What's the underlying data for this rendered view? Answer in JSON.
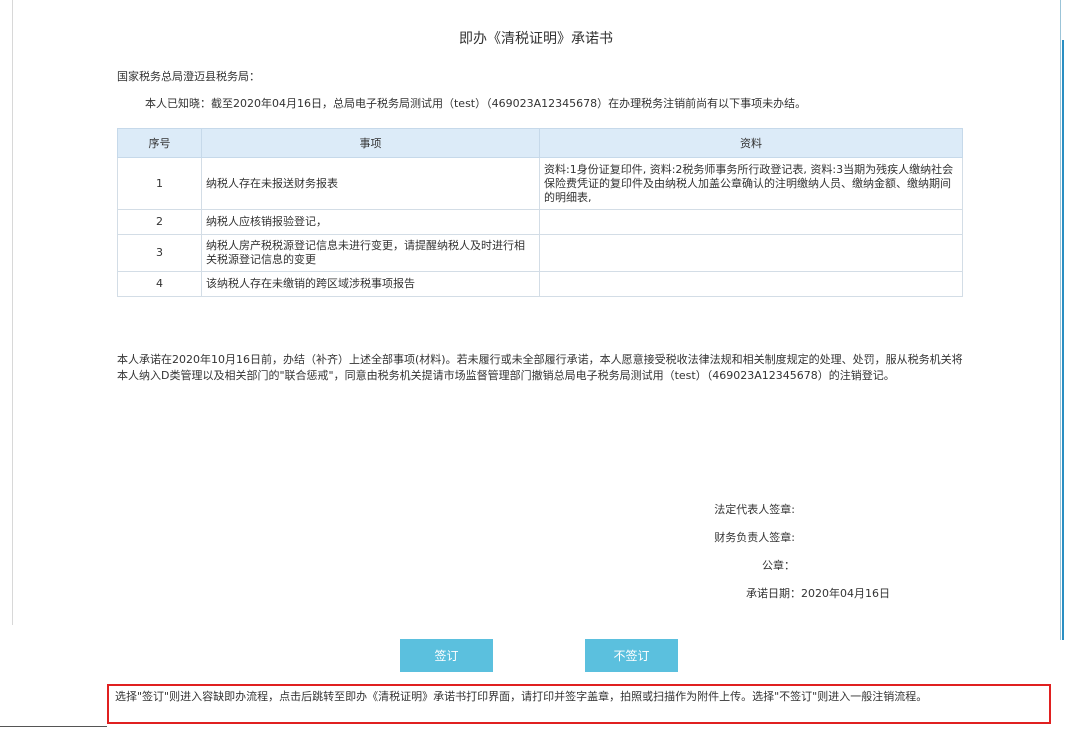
{
  "title": "即办《清税证明》承诺书",
  "addressee": "国家税务总局澄迈县税务局：",
  "intro": "本人已知晓：截至2020年04月16日，总局电子税务局测试用（test）（469023A12345678）在办理税务注销前尚有以下事项未办结。",
  "table": {
    "headers": [
      "序号",
      "事项",
      "资料"
    ],
    "rows": [
      {
        "num": "1",
        "item": "纳税人存在未报送财务报表",
        "material": "资料:1身份证复印件, 资料:2税务师事务所行政登记表, 资料:3当期为残疾人缴纳社会保险费凭证的复印件及由纳税人加盖公章确认的注明缴纳人员、缴纳金额、缴纳期间的明细表,"
      },
      {
        "num": "2",
        "item": "纳税人应核销报验登记，",
        "material": ""
      },
      {
        "num": "3",
        "item": "纳税人房产税税源登记信息未进行变更，请提醒纳税人及时进行相关税源登记信息的变更",
        "material": ""
      },
      {
        "num": "4",
        "item": "该纳税人存在未缴销的跨区域涉税事项报告",
        "material": ""
      }
    ]
  },
  "pledge": "本人承诺在2020年10月16日前，办结（补齐）上述全部事项(材料)。若未履行或未全部履行承诺，本人愿意接受税收法律法规和相关制度规定的处理、处罚，服从税务机关将本人纳入D类管理以及相关部门的\"联合惩戒\"，同意由税务机关提请市场监督管理部门撤销总局电子税务局测试用（test）（469023A12345678）的注销登记。",
  "signatures": {
    "legal_rep": "法定代表人签章:",
    "finance": "财务负责人签章:",
    "seal": "公章：",
    "date": "承诺日期：2020年04月16日"
  },
  "buttons": {
    "sign": "签订",
    "no_sign": "不签订"
  },
  "note": "选择\"签订\"则进入容缺即办流程，点击后跳转至即办《清税证明》承诺书打印界面，请打印并签字盖章，拍照或扫描作为附件上传。选择\"不签订\"则进入一般注销流程。",
  "colors": {
    "button_bg": "#5bc0de",
    "header_bg": "#dcebf8",
    "note_border": "#e02020"
  }
}
